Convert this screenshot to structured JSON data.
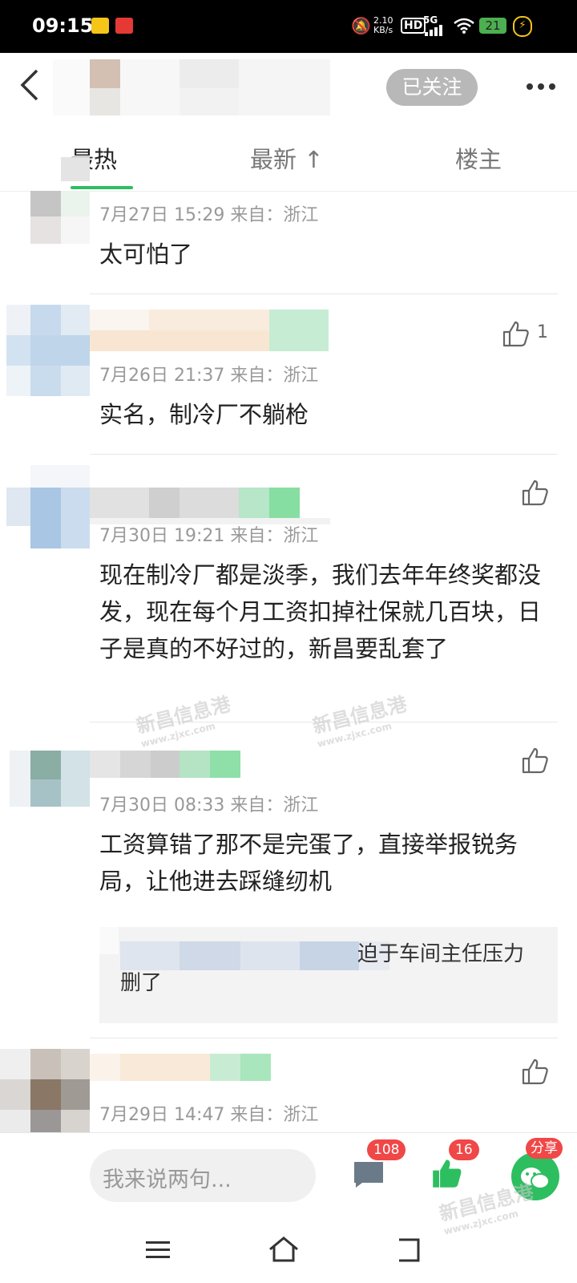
{
  "status_bar": {
    "time": "09:15",
    "network_speed": "2.10\nKB/s",
    "hd": "HD",
    "signal": "5G",
    "battery": "21"
  },
  "header": {
    "back_icon": "chevron-left-icon",
    "follow_label": "已关注",
    "more_icon": "more-dots-icon"
  },
  "tabs": [
    {
      "label": "最热",
      "active": true
    },
    {
      "label": "最新 ↑",
      "active": false
    },
    {
      "label": "楼主",
      "active": false
    }
  ],
  "comments": [
    {
      "time": "7月27日 15:29  来自：浙江",
      "text": "太可怕了",
      "likes": ""
    },
    {
      "time": "7月26日 21:37  来自：浙江",
      "text": "实名，制冷厂不躺枪",
      "likes": "1"
    },
    {
      "time": "7月30日 19:21  来自：浙江",
      "text": "现在制冷厂都是淡季，我们去年年终奖都没发，现在每个月工资扣掉社保就几百块，日子是真的不好过的，新昌要乱套了",
      "likes": ""
    },
    {
      "time": "7月30日 08:33  来自：浙江",
      "text": "工资算错了那不是完蛋了，直接举报锐务局，让他进去踩缝纫机",
      "likes": "",
      "reply": "迫于车间主任压力删了"
    },
    {
      "time": "7月29日 14:47  来自：浙江",
      "text": "",
      "likes": ""
    }
  ],
  "bottom_bar": {
    "input_placeholder": "我来说两句...",
    "comment_count": "108",
    "like_count": "16",
    "share_label": "分享"
  },
  "watermark": {
    "text": "新昌信息港",
    "url": "www.zjxc.com"
  },
  "colors": {
    "accent": "#2dbe60",
    "badge": "#f04747",
    "follow_bg": "#b8b8b8"
  }
}
